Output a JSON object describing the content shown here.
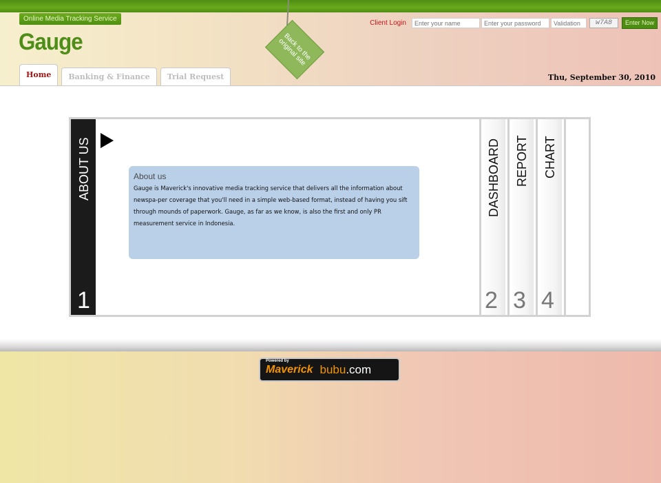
{
  "header": {
    "tagline": "Online Media Tracking Service",
    "logo": "Gauge",
    "hangtag": "Back to the original site",
    "date": "Thu, September 30, 2010"
  },
  "login": {
    "label": "Client Login",
    "name_placeholder": "Enter your name",
    "password_placeholder": "Enter your password",
    "validation_placeholder": "Validation",
    "captcha": "w7A8",
    "submit": "Enter Now"
  },
  "tabs": [
    {
      "label": "Home",
      "active": true
    },
    {
      "label": "Banking & Finance",
      "active": false
    },
    {
      "label": "Trial Request",
      "active": false
    }
  ],
  "panel": {
    "left": {
      "label": "ABOUT US",
      "number": "1"
    },
    "about": {
      "title": "About us",
      "text": "Gauge is Maverick's innovative media tracking service that delivers all the information about newspa-per coverage that you'll need in a simple web-based format, instead of having you sift through mounds of paperwork. Gauge, as far as we know, is also the first and only PR measurement service in Indonesia."
    },
    "right_tabs": [
      {
        "label": "DASHBOARD",
        "number": "2"
      },
      {
        "label": "REPORT",
        "number": "3"
      },
      {
        "label": "CHART",
        "number": "4"
      }
    ]
  },
  "footer": {
    "powered_by": "Powered by",
    "maverick": "Maverick",
    "bubu": "bubu",
    "bubu_com": ".com"
  },
  "colors": {
    "brand_green": "#4e8d18",
    "login_red": "#c2171b",
    "about_bg": "#bad0e8",
    "footer_orange": "#f29300"
  }
}
